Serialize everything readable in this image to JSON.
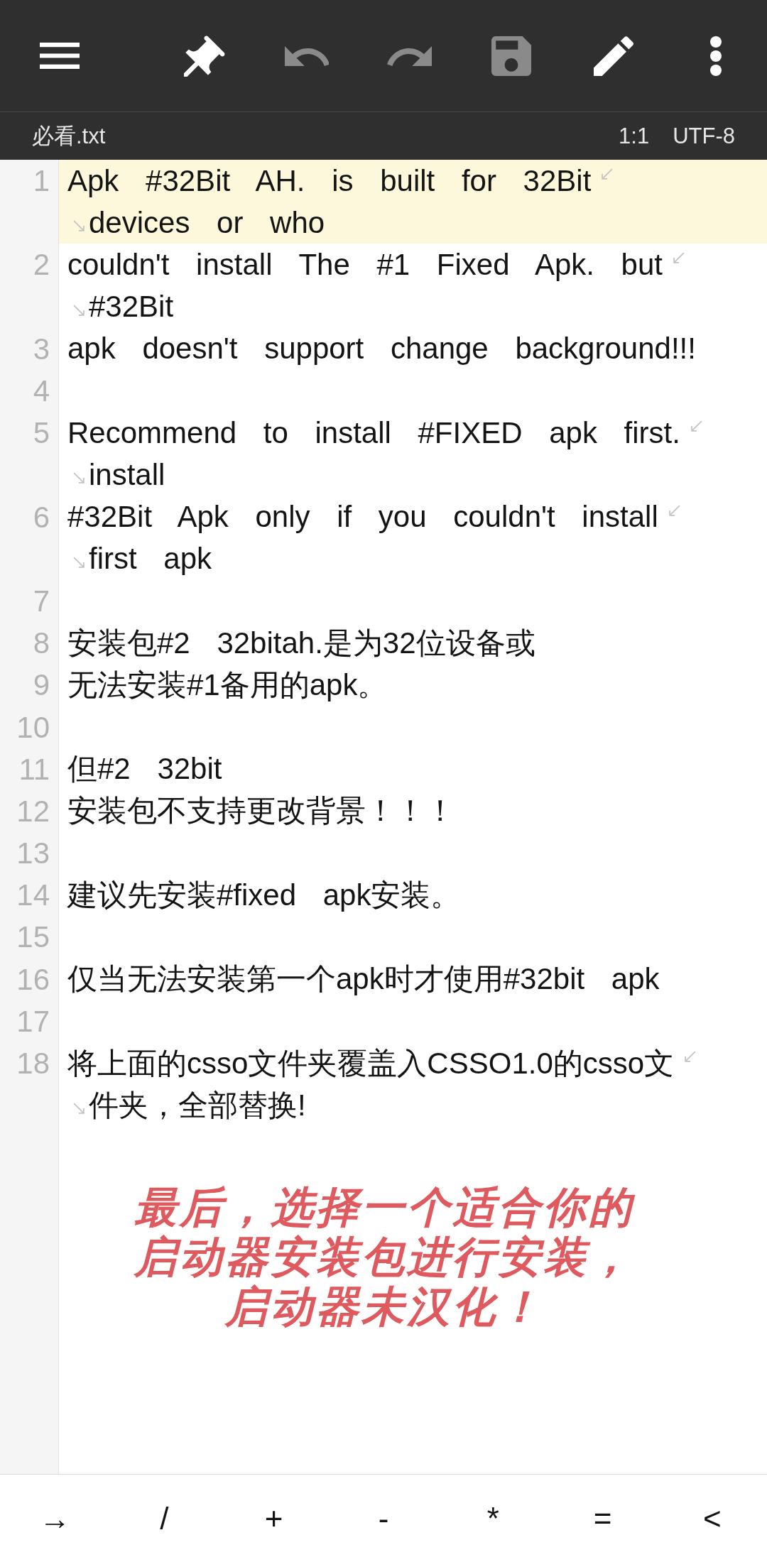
{
  "toolbar": {
    "buttons": [
      {
        "disabled": false
      },
      {
        "disabled": false
      },
      {
        "disabled": true
      },
      {
        "disabled": true
      },
      {
        "disabled": true
      },
      {
        "disabled": false
      },
      {
        "disabled": false
      }
    ]
  },
  "status_bar": {
    "file_name": "必看.txt",
    "cursor_position": "1:1",
    "encoding": "UTF-8"
  },
  "editor": {
    "lines": [
      {
        "number": "1",
        "current": true,
        "segments": [
          "Apk #32Bit AH. is built for 32Bit",
          "devices or who"
        ]
      },
      {
        "number": "2",
        "current": false,
        "segments": [
          "couldn't install The #1 Fixed Apk. but",
          "#32Bit"
        ]
      },
      {
        "number": "3",
        "current": false,
        "segments": [
          "apk doesn't support change background!!!"
        ]
      },
      {
        "number": "4",
        "current": false
      },
      {
        "number": "5",
        "current": false,
        "segments": [
          "Recommend to install #FIXED apk first.",
          "install"
        ]
      },
      {
        "number": "6",
        "current": false,
        "segments": [
          "#32Bit Apk only if you couldn't install",
          "first apk"
        ]
      },
      {
        "number": "7",
        "current": false
      },
      {
        "number": "8",
        "current": false,
        "segments": [
          "安装包#2 32bitah.是为32位设备或"
        ]
      },
      {
        "number": "9",
        "current": false,
        "segments": [
          "无法安装#1备用的apk。"
        ]
      },
      {
        "number": "10",
        "current": false
      },
      {
        "number": "11",
        "current": false,
        "segments": [
          "但#2 32bit"
        ]
      },
      {
        "number": "12",
        "current": false,
        "segments": [
          "安装包不支持更改背景！！！"
        ]
      },
      {
        "number": "13",
        "current": false
      },
      {
        "number": "14",
        "current": false,
        "segments": [
          "建议先安装#fixed apk安装。"
        ]
      },
      {
        "number": "15",
        "current": false
      },
      {
        "number": "16",
        "current": false,
        "segments": [
          "仅当无法安装第一个apk时才使用#32bit apk"
        ]
      },
      {
        "number": "17",
        "current": false
      },
      {
        "number": "18",
        "current": false,
        "segments": [
          "将上面的csso文件夹覆盖入CSSO1.0的csso文",
          "件夹，全部替换!"
        ]
      }
    ],
    "overlay_note": {
      "lines": [
        "最后，选择一个适合你的",
        "启动器安装包进行安装，",
        "启动器未汉化！"
      ]
    }
  },
  "symbol_keys": [
    "→",
    "/",
    "+",
    "-",
    "*",
    "=",
    "<"
  ]
}
